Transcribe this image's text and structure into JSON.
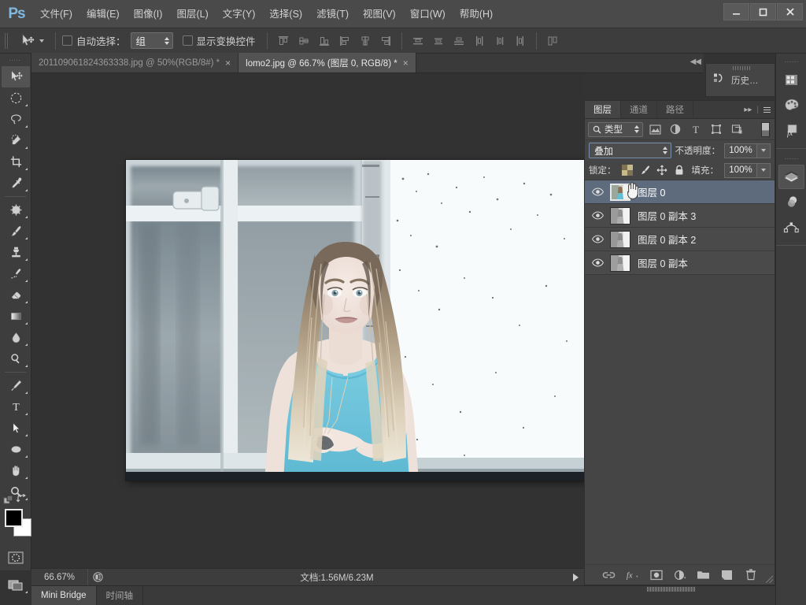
{
  "app": {
    "logo_text": "Ps",
    "window_controls": {
      "minimize": "minimize-icon",
      "maximize": "maximize-icon",
      "close": "close-icon"
    }
  },
  "menubar": {
    "items": [
      {
        "label": "文件(F)"
      },
      {
        "label": "编辑(E)"
      },
      {
        "label": "图像(I)"
      },
      {
        "label": "图层(L)"
      },
      {
        "label": "文字(Y)"
      },
      {
        "label": "选择(S)"
      },
      {
        "label": "滤镜(T)"
      },
      {
        "label": "视图(V)"
      },
      {
        "label": "窗口(W)"
      },
      {
        "label": "帮助(H)"
      }
    ]
  },
  "options_bar": {
    "tool_icon": "move-tool-icon",
    "auto_select_label": "自动选择：",
    "auto_select_value": "组",
    "show_transform_label": "显示变换控件",
    "align_icons": [
      "align-top-edges-icon",
      "align-vertical-centers-icon",
      "align-bottom-edges-icon",
      "align-left-edges-icon",
      "align-horizontal-centers-icon",
      "align-right-edges-icon"
    ],
    "distribute_icons": [
      "distribute-top-edges-icon",
      "distribute-vertical-centers-icon",
      "distribute-bottom-edges-icon",
      "distribute-left-edges-icon",
      "distribute-horizontal-centers-icon",
      "distribute-right-edges-icon"
    ],
    "auto_align_icon": "auto-align-layers-icon"
  },
  "document_tabs": [
    {
      "label": "201109061824363338.jpg @ 50%(RGB/8#) *",
      "close": "×",
      "active": false
    },
    {
      "label": "lomo2.jpg @ 66.7% (图层 0, RGB/8) *",
      "close": "×",
      "active": true
    }
  ],
  "toolbar": {
    "tools": [
      {
        "name": "move-tool",
        "active": true,
        "submenu": false
      },
      {
        "name": "rectangular-marquee-tool",
        "active": false,
        "submenu": true
      },
      {
        "name": "lasso-tool",
        "active": false,
        "submenu": true
      },
      {
        "name": "quick-selection-tool",
        "active": false,
        "submenu": true
      },
      {
        "name": "crop-tool",
        "active": false,
        "submenu": true
      },
      {
        "name": "eyedropper-tool",
        "active": false,
        "submenu": true
      },
      {
        "name": "spot-healing-brush-tool",
        "active": false,
        "submenu": true
      },
      {
        "name": "brush-tool",
        "active": false,
        "submenu": true
      },
      {
        "name": "clone-stamp-tool",
        "active": false,
        "submenu": true
      },
      {
        "name": "history-brush-tool",
        "active": false,
        "submenu": true
      },
      {
        "name": "eraser-tool",
        "active": false,
        "submenu": true
      },
      {
        "name": "gradient-tool",
        "active": false,
        "submenu": true
      },
      {
        "name": "blur-tool",
        "active": false,
        "submenu": true
      },
      {
        "name": "dodge-tool",
        "active": false,
        "submenu": true
      },
      {
        "name": "pen-tool",
        "active": false,
        "submenu": true
      },
      {
        "name": "horizontal-type-tool",
        "active": false,
        "submenu": true
      },
      {
        "name": "path-selection-tool",
        "active": false,
        "submenu": true
      },
      {
        "name": "ellipse-tool",
        "active": false,
        "submenu": true
      },
      {
        "name": "hand-tool",
        "active": false,
        "submenu": true
      },
      {
        "name": "zoom-tool",
        "active": false,
        "submenu": true
      }
    ],
    "foreground_color": "#000000",
    "background_color": "#ffffff",
    "quick_mask_icon": "quick-mask-icon",
    "screen_mode_icon": "screen-mode-icon"
  },
  "canvas": {
    "description": "lomo2.jpg — 高调处理的人像：长发金发女子穿青蓝色背心站在斑驳窗户前",
    "colors": {
      "tank_top": "#62c4dd",
      "skin": "#f3e4dd",
      "hair_light": "#e3d2bb",
      "hair_dark": "#7b6551",
      "wall": "#f7fafb",
      "window_glass": "#8e9ba2",
      "frame": "#dfe7ea",
      "background": "#323232"
    }
  },
  "status_bar": {
    "zoom": "66.67%",
    "doc_icon": "document-icon",
    "doc_info": "文档:1.56M/6.23M",
    "expand_icon": "play-arrow-icon"
  },
  "bottom_tabs": [
    {
      "label": "Mini Bridge",
      "active": true
    },
    {
      "label": "时间轴",
      "active": false
    }
  ],
  "history_panel": {
    "icon": "history-icon",
    "label": "历史…"
  },
  "right_rail": {
    "group_one": [
      {
        "name": "color-swatches-icon",
        "active": false
      },
      {
        "name": "color-palette-icon",
        "active": false
      },
      {
        "name": "styles-fx-icon",
        "active": false
      }
    ],
    "group_two": [
      {
        "name": "layers-icon",
        "active": true
      },
      {
        "name": "channels-icon",
        "active": false
      },
      {
        "name": "paths-icon",
        "active": false
      }
    ]
  },
  "layers_panel": {
    "tabs": [
      {
        "label": "图层",
        "active": true
      },
      {
        "label": "通道",
        "active": false
      },
      {
        "label": "路径",
        "active": false
      }
    ],
    "collapse_icon": "collapse-panel-icon",
    "menu_icon": "panel-menu-icon",
    "filter": {
      "search_icon": "search-icon",
      "type_label": "类型",
      "icons": [
        "filter-pixel-icon",
        "filter-adjustment-icon",
        "filter-type-icon",
        "filter-shape-icon",
        "filter-smart-object-icon"
      ],
      "toggle": "filter-toggle"
    },
    "blend_mode": "叠加",
    "opacity_label": "不透明度：",
    "opacity_value": "100%",
    "lock_label": "锁定：",
    "lock_icons": [
      "lock-transparent-pixels-icon",
      "lock-image-pixels-icon",
      "lock-position-icon",
      "lock-all-icon"
    ],
    "fill_label": "填充：",
    "fill_value": "100%",
    "layers": [
      {
        "name": "图层 0",
        "visible": true,
        "selected": true,
        "thumb": "color"
      },
      {
        "name": "图层 0 副本 3",
        "visible": true,
        "selected": false,
        "thumb": "gray"
      },
      {
        "name": "图层 0 副本 2",
        "visible": true,
        "selected": false,
        "thumb": "gray"
      },
      {
        "name": "图层 0 副本",
        "visible": true,
        "selected": false,
        "thumb": "gray"
      }
    ],
    "bottom_buttons": [
      {
        "name": "link-layers-icon"
      },
      {
        "name": "layer-style-fx-icon"
      },
      {
        "name": "add-layer-mask-icon"
      },
      {
        "name": "new-adjustment-layer-icon"
      },
      {
        "name": "new-group-icon"
      },
      {
        "name": "new-layer-icon"
      },
      {
        "name": "delete-layer-icon"
      }
    ]
  }
}
